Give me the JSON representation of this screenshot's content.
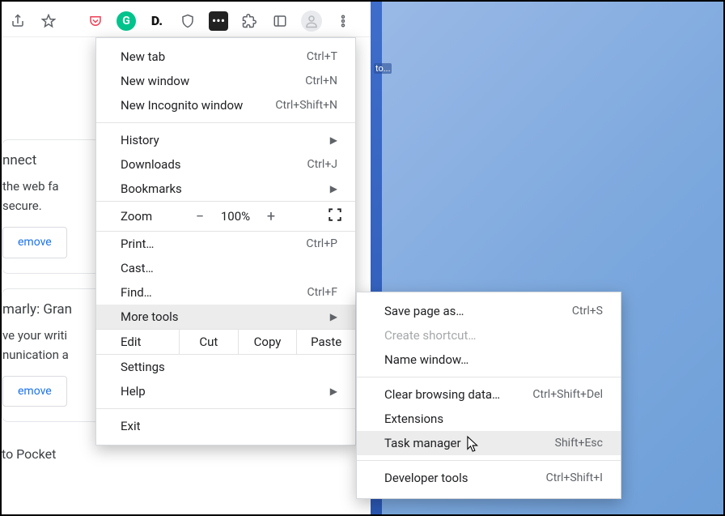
{
  "toolbar": {
    "icons": [
      "share-icon",
      "star-icon",
      "pocket-icon",
      "grammarly-icon",
      "dlane-icon",
      "ublock-icon",
      "lastpass-icon",
      "extensions-icon",
      "sidepanel-icon",
      "profile-icon",
      "menu-icon"
    ]
  },
  "page": {
    "card1": {
      "title": "nnect",
      "l1": "the web fa",
      "l2": "secure.",
      "btn": "emove"
    },
    "card2": {
      "title": "marly: Gran",
      "l1": "ve your writi",
      "l2": "nunication a",
      "btn": "emove"
    },
    "tail": "to Pocket"
  },
  "desk": {
    "label": "to..."
  },
  "menu": {
    "new_tab": {
      "label": "New tab",
      "sc": "Ctrl+T"
    },
    "new_window": {
      "label": "New window",
      "sc": "Ctrl+N"
    },
    "incognito": {
      "label": "New Incognito window",
      "sc": "Ctrl+Shift+N"
    },
    "history": {
      "label": "History"
    },
    "downloads": {
      "label": "Downloads",
      "sc": "Ctrl+J"
    },
    "bookmarks": {
      "label": "Bookmarks"
    },
    "zoom": {
      "label": "Zoom",
      "minus": "−",
      "value": "100%",
      "plus": "+"
    },
    "print": {
      "label": "Print…",
      "sc": "Ctrl+P"
    },
    "cast": {
      "label": "Cast…"
    },
    "find": {
      "label": "Find…",
      "sc": "Ctrl+F"
    },
    "more_tools": {
      "label": "More tools"
    },
    "edit": {
      "label": "Edit",
      "cut": "Cut",
      "copy": "Copy",
      "paste": "Paste"
    },
    "settings": {
      "label": "Settings"
    },
    "help": {
      "label": "Help"
    },
    "exit": {
      "label": "Exit"
    }
  },
  "submenu": {
    "save_page": {
      "label": "Save page as…",
      "sc": "Ctrl+S"
    },
    "shortcut": {
      "label": "Create shortcut…"
    },
    "name_window": {
      "label": "Name window…"
    },
    "clear_data": {
      "label": "Clear browsing data…",
      "sc": "Ctrl+Shift+Del"
    },
    "extensions": {
      "label": "Extensions"
    },
    "task_mgr": {
      "label": "Task manager",
      "sc": "Shift+Esc"
    },
    "dev_tools": {
      "label": "Developer tools",
      "sc": "Ctrl+Shift+I"
    }
  }
}
